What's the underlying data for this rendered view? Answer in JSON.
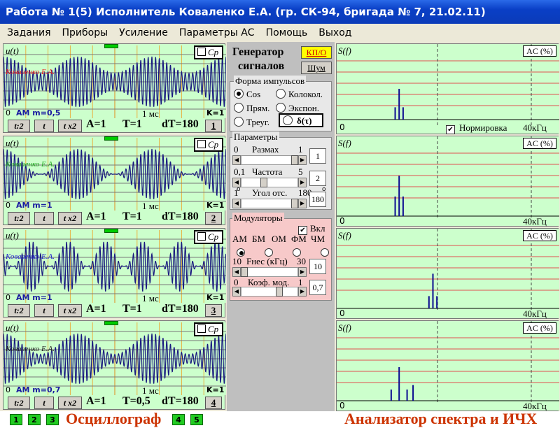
{
  "title": "Работа № 1(5)  Исполнитель Коваленко Е.А. (гр. СК-94, бригада № 7, 21.02.11)",
  "menu": [
    "Задания",
    "Приборы",
    "Усиление",
    "Параметры АС",
    "Помощь",
    "Выход"
  ],
  "osc": [
    {
      "name_label": "Коваленко Е.А.",
      "mod": "AM m=0,5",
      "mod_index": 0.5,
      "carrier_cycles": 20,
      "mod_cycles": 3,
      "phase": 0,
      "time": "1 мс",
      "K": "K=1",
      "A": "A=1",
      "T": "T=1",
      "dT": "dT=180",
      "num": "1",
      "zero": "0",
      "label_color": "#ee2222"
    },
    {
      "name_label": "Коваленко Е.А.",
      "mod": "AM m=1",
      "mod_index": 1,
      "carrier_cycles": 20,
      "mod_cycles": 3,
      "phase": 0,
      "time": "1 мс",
      "K": "K=1",
      "A": "A=1",
      "T": "T=1",
      "dT": "dT=180",
      "num": "2",
      "zero": "0",
      "label_color": "#22aa22"
    },
    {
      "name_label": "Коваленко Е.А.",
      "mod": "AM m=1",
      "mod_index": 1,
      "carrier_cycles": 20,
      "mod_cycles": 6,
      "phase": 0.5,
      "time": "1 мс",
      "K": "K=1",
      "A": "A=1",
      "T": "T=1",
      "dT": "dT=180",
      "num": "3",
      "zero": "0",
      "label_color": "#2222cc"
    },
    {
      "name_label": "Коваленко Е.А.",
      "mod": "AM m=0,7",
      "mod_index": 0.7,
      "carrier_cycles": 20,
      "mod_cycles": 3,
      "phase": 0,
      "time": "1 мс",
      "K": "K=1",
      "A": "A=1",
      "T": "T=0,5",
      "dT": "dT=180",
      "num": "4",
      "zero": "0",
      "label_color": "#222222"
    }
  ],
  "osc_buttons": {
    "div": "t:2",
    "t": "t",
    "mul": "t x2",
    "cp": "Cp",
    "uft": "u(t)"
  },
  "generator": {
    "title_line1": "Генератор",
    "title_line2": "сигналов",
    "kpo": "КП/О",
    "shum": "Шум",
    "form_legend": "Форма  импульсов",
    "forms": [
      {
        "label": "Cos",
        "on": true
      },
      {
        "label": "Колокол.",
        "on": false
      },
      {
        "label": "Прям.",
        "on": false
      },
      {
        "label": "Экспон.",
        "on": false
      },
      {
        "label": "Треуг.",
        "on": false
      }
    ],
    "delta": "δ(τ)",
    "params_legend": "Параметры",
    "razmah": {
      "label": "Размах",
      "min": "0",
      "max": "1",
      "value": "1"
    },
    "chastota": {
      "label": "Частота",
      "min": "0,1",
      "max": "5",
      "value": "2"
    },
    "ugol": {
      "label": "Угол отс.",
      "min": "1",
      "max": "180",
      "value": "180",
      "deg_min": "o",
      "deg_max": "o"
    },
    "mod_legend": "Модуляторы",
    "vkl": "Вкл",
    "mod_types": [
      "АМ",
      "БМ",
      "ОМ",
      "ФМ",
      "ЧМ"
    ],
    "mod_selected": 0,
    "fnes": {
      "label": "Fнес (кГц)",
      "min": "10",
      "max": "30",
      "value": "10"
    },
    "koef": {
      "label": "Коэф. мод.",
      "min": "0",
      "max": "1",
      "value": "0,7"
    }
  },
  "spec": [
    {
      "peaks": [
        [
          0.28,
          0.22
        ],
        [
          0.3,
          0.55
        ],
        [
          0.32,
          0.22
        ]
      ],
      "norm": true
    },
    {
      "peaks": [
        [
          0.28,
          0.35
        ],
        [
          0.3,
          0.72
        ],
        [
          0.32,
          0.35
        ]
      ],
      "norm": false
    },
    {
      "peaks": [
        [
          0.45,
          0.22
        ],
        [
          0.47,
          0.62
        ],
        [
          0.49,
          0.22
        ]
      ],
      "norm": false
    },
    {
      "peaks": [
        [
          0.26,
          0.2
        ],
        [
          0.3,
          0.6
        ],
        [
          0.34,
          0.2
        ],
        [
          0.37,
          0.28
        ]
      ],
      "norm": false
    }
  ],
  "spec_labels": {
    "sf": "S(f)",
    "ac": "AC (%)",
    "zero": "0",
    "freq": "40кГц",
    "norm_label": "Нормировка"
  },
  "bottom": {
    "osc_buttons": [
      "1",
      "2",
      "3",
      "4",
      "5"
    ],
    "osc_title": "Осциллограф",
    "spec_title": "Анализатор спектра и ИЧХ"
  }
}
